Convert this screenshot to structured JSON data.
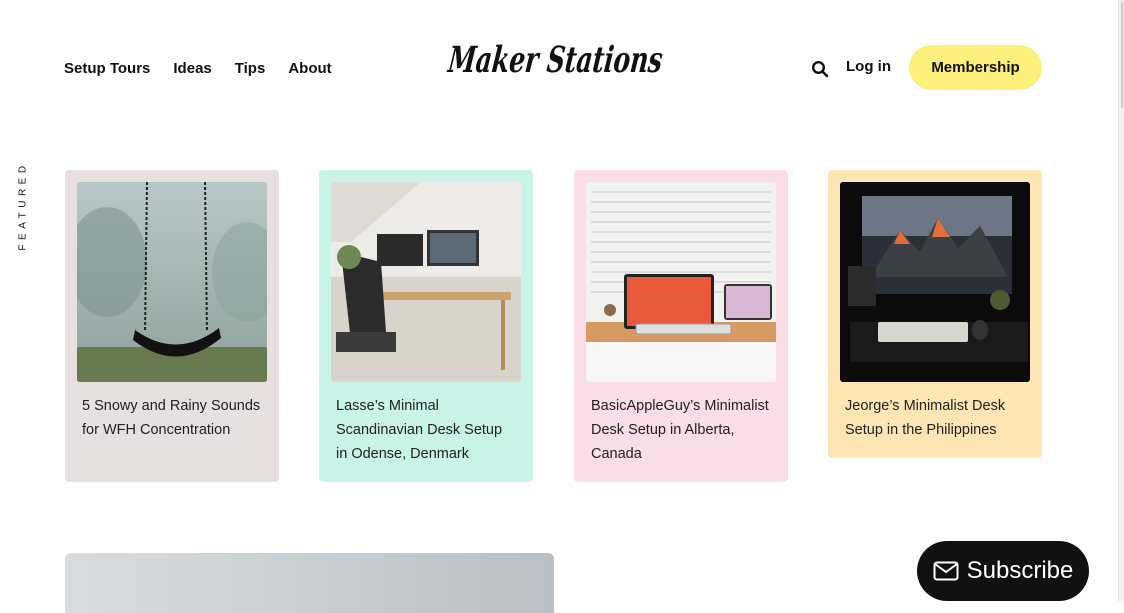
{
  "nav": {
    "items": [
      {
        "label": "Setup Tours"
      },
      {
        "label": "Ideas"
      },
      {
        "label": "Tips"
      },
      {
        "label": "About"
      }
    ]
  },
  "logo": {
    "text": "Maker Stations"
  },
  "header": {
    "search_icon": "search-icon",
    "login_label": "Log in",
    "membership_label": "Membership"
  },
  "featured": {
    "label": "FEATURED",
    "cards": [
      {
        "title": "5 Snowy and Rainy Sounds for WFH Concentration",
        "bg": "#e7e0e0"
      },
      {
        "title": "Lasse’s Minimal Scandinavian Desk Setup in Odense, Denmark",
        "bg": "#c9f3e7"
      },
      {
        "title": "BasicAppleGuy’s Minimalist Desk Setup in Alberta, Canada",
        "bg": "#f9dde7"
      },
      {
        "title": "Jeorge’s Minimalist Desk Setup in the Philippines",
        "bg": "#fde6b4"
      }
    ]
  },
  "subscribe": {
    "label": "Subscribe",
    "icon": "mail-icon"
  },
  "colors": {
    "accent": "#fbf07c",
    "dark": "#111111"
  }
}
